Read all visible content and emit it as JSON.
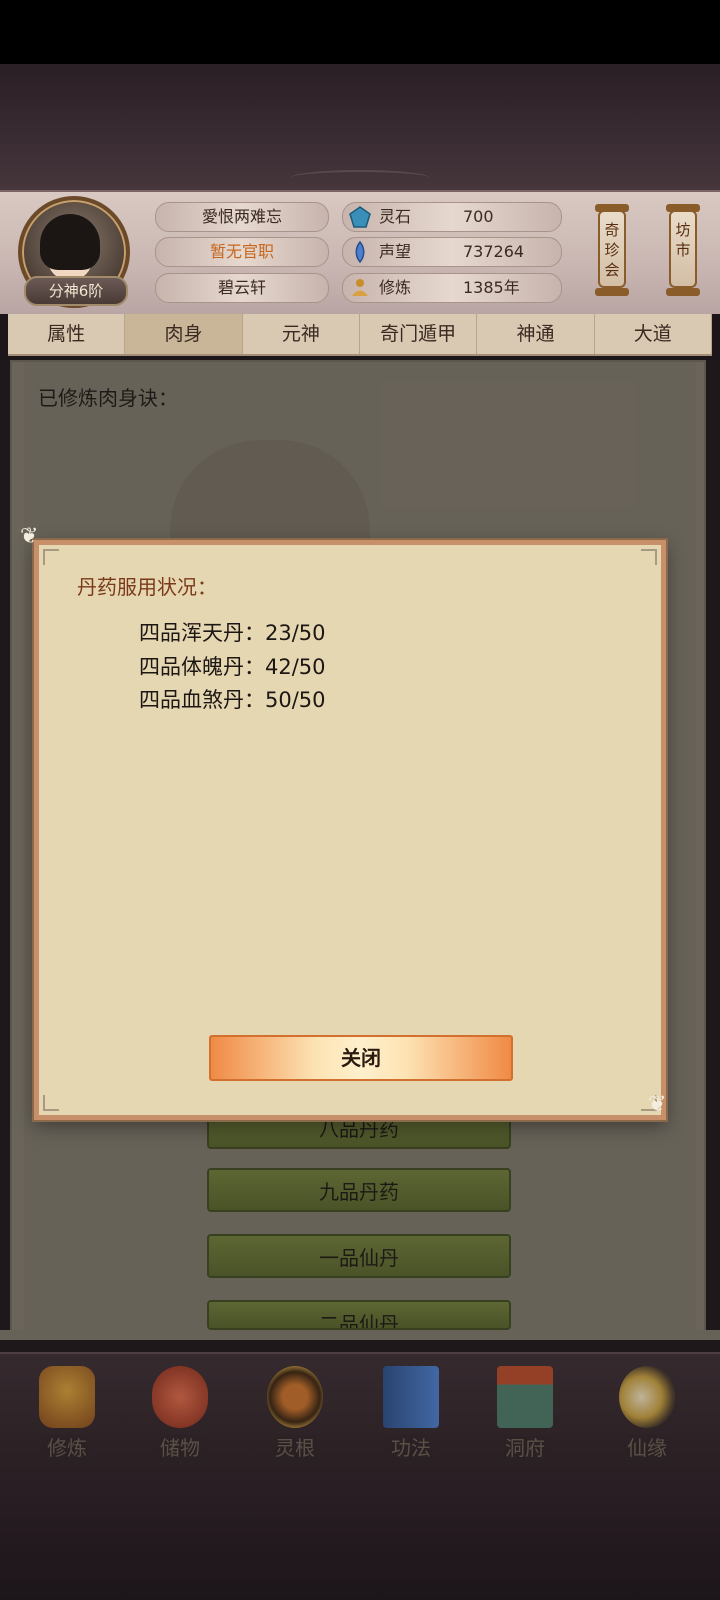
{
  "header": {
    "rank": "分神6阶",
    "player_name": "愛恨两难忘",
    "official_title": "暂无官职",
    "location": "碧云轩",
    "stats": [
      {
        "label": "灵石",
        "value": "700",
        "icon": "spirit-stone-icon"
      },
      {
        "label": "声望",
        "value": "737264",
        "icon": "reputation-icon"
      },
      {
        "label": "修炼",
        "value": "1385年",
        "icon": "meditation-icon"
      }
    ],
    "lanterns": [
      {
        "label": "奇珍会"
      },
      {
        "label": "坊市"
      }
    ]
  },
  "tabs": [
    "属性",
    "肉身",
    "元神",
    "奇门遁甲",
    "神通",
    "大道"
  ],
  "active_tab": "肉身",
  "main": {
    "cultivated_label": "已修炼肉身诀：",
    "list_buttons": [
      "八品丹药",
      "九品丹药",
      "一品仙丹",
      "二品仙丹"
    ]
  },
  "dialog": {
    "title": "丹药服用状况：",
    "pills": [
      {
        "name": "四品浑天丹：",
        "value": "23/50"
      },
      {
        "name": "四品体魄丹：",
        "value": "42/50"
      },
      {
        "name": "四品血煞丹：",
        "value": "50/50"
      }
    ],
    "close_label": "关闭"
  },
  "bottom_nav": [
    {
      "label": "修炼",
      "icon": "cultivate-icon"
    },
    {
      "label": "储物",
      "icon": "storage-bag-icon"
    },
    {
      "label": "灵根",
      "icon": "spirit-root-icon"
    },
    {
      "label": "功法",
      "icon": "skill-book-icon"
    },
    {
      "label": "洞府",
      "icon": "cave-dwelling-icon"
    },
    {
      "label": "仙缘",
      "icon": "immortal-fate-icon"
    }
  ],
  "colors": {
    "official_title": "#c8661e",
    "dialog_title": "#7a3a1a",
    "green_button": "#6f7d3a",
    "close_button": "#f08a45"
  }
}
